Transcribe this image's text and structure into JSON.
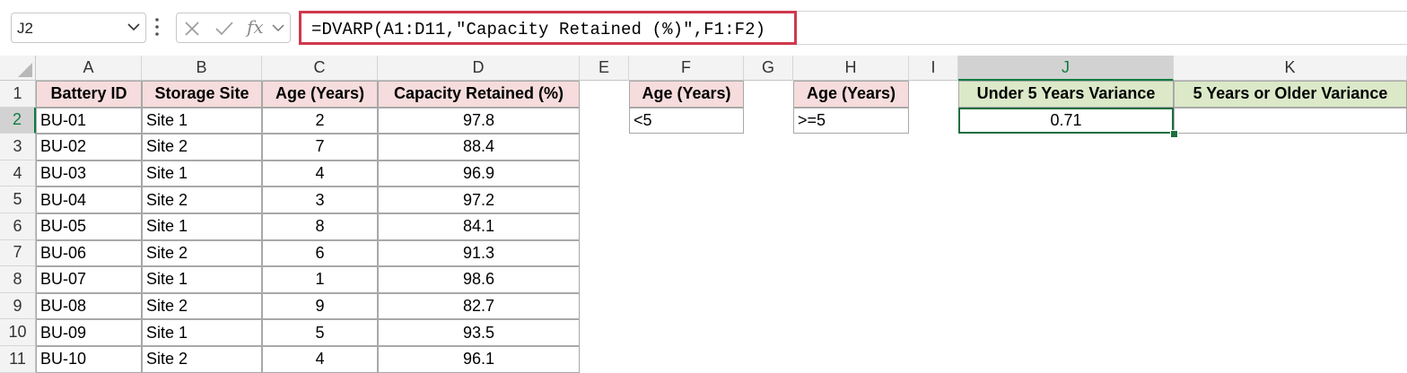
{
  "name_box": {
    "value": "J2"
  },
  "formula_bar": {
    "formula": "=DVARP(A1:D11,\"Capacity Retained (%)\",F1:F2)"
  },
  "columns": [
    "A",
    "B",
    "C",
    "D",
    "E",
    "F",
    "G",
    "H",
    "I",
    "J",
    "K"
  ],
  "rows": [
    "1",
    "2",
    "3",
    "4",
    "5",
    "6",
    "7",
    "8",
    "9",
    "10",
    "11"
  ],
  "table": {
    "headers": [
      "Battery ID",
      "Storage Site",
      "Age (Years)",
      "Capacity Retained (%)"
    ],
    "rows": [
      [
        "BU-01",
        "Site 1",
        "2",
        "97.8"
      ],
      [
        "BU-02",
        "Site 2",
        "7",
        "88.4"
      ],
      [
        "BU-03",
        "Site 1",
        "4",
        "96.9"
      ],
      [
        "BU-04",
        "Site 2",
        "3",
        "97.2"
      ],
      [
        "BU-05",
        "Site 1",
        "8",
        "84.1"
      ],
      [
        "BU-06",
        "Site 2",
        "6",
        "91.3"
      ],
      [
        "BU-07",
        "Site 1",
        "1",
        "98.6"
      ],
      [
        "BU-08",
        "Site 2",
        "9",
        "82.7"
      ],
      [
        "BU-09",
        "Site 1",
        "5",
        "93.5"
      ],
      [
        "BU-10",
        "Site 2",
        "4",
        "96.1"
      ]
    ]
  },
  "criteria_f": {
    "header": "Age (Years)",
    "value": "<5"
  },
  "criteria_h": {
    "header": "Age (Years)",
    "value": ">=5"
  },
  "results": {
    "j_header": "Under 5 Years Variance",
    "k_header": "5 Years or Older Variance",
    "j_value": "0.71",
    "k_value": ""
  },
  "colors": {
    "accent": "#107c41",
    "formula_highlight": "#d0394d",
    "header_pink": "#f6dcdc",
    "header_green": "#dbe9c8"
  }
}
